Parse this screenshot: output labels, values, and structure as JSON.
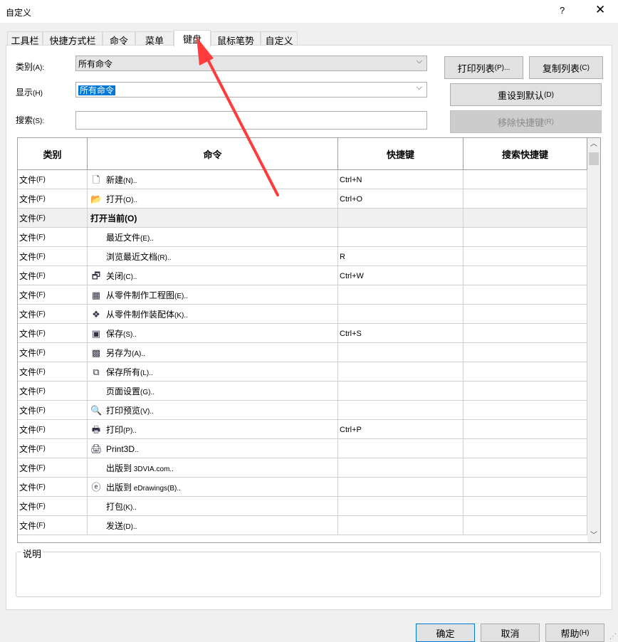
{
  "window": {
    "title": "自定义",
    "help_glyph": "?",
    "close_glyph": "✕"
  },
  "tabs": [
    {
      "label": "工具栏"
    },
    {
      "label": "快捷方式栏"
    },
    {
      "label": "命令"
    },
    {
      "label": "菜单"
    },
    {
      "label": "键盘",
      "active": true
    },
    {
      "label": "鼠标笔势"
    },
    {
      "label": "自定义"
    }
  ],
  "filters": {
    "category_label": "类别",
    "category_accel": "(A):",
    "category_value": "所有命令",
    "show_label": "显示",
    "show_accel": "(H)",
    "show_value": "所有命令",
    "search_label": "搜索",
    "search_accel": "(S):",
    "search_value": ""
  },
  "buttons": {
    "print_list": "打印列表",
    "print_list_accel": "(P)...",
    "copy_list": "复制列表",
    "copy_list_accel": "(C)",
    "reset_default": "重设到默认",
    "reset_default_accel": "(D)",
    "remove_shortcut": "移除快捷键",
    "remove_shortcut_accel": "(R)"
  },
  "table": {
    "headers": [
      "类别",
      "命令",
      "快捷键",
      "搜索快捷键"
    ],
    "rows": [
      {
        "cat": "文件",
        "cat_accel": "(F)",
        "cmd": "新建",
        "cmd_accel": "(N)..",
        "key": "Ctrl+N",
        "icon": "new-document-icon",
        "glyph": "🗋"
      },
      {
        "cat": "文件",
        "cat_accel": "(F)",
        "cmd": "打开",
        "cmd_accel": "(O)..",
        "key": "Ctrl+O",
        "icon": "open-folder-icon",
        "glyph": "📂"
      },
      {
        "cat": "文件",
        "cat_accel": "(F)",
        "cmd": "打开当前(O)",
        "cmd_accel": "",
        "key": "",
        "icon": "",
        "glyph": "",
        "group": true
      },
      {
        "cat": "文件",
        "cat_accel": "(F)",
        "cmd": "最近文件",
        "cmd_accel": "(E)..",
        "key": "",
        "icon": "",
        "glyph": ""
      },
      {
        "cat": "文件",
        "cat_accel": "(F)",
        "cmd": "浏览最近文档",
        "cmd_accel": "(R)..",
        "key": "R",
        "icon": "",
        "glyph": ""
      },
      {
        "cat": "文件",
        "cat_accel": "(F)",
        "cmd": "关闭",
        "cmd_accel": "(C)..",
        "key": "Ctrl+W",
        "icon": "close-document-icon",
        "glyph": "🗗"
      },
      {
        "cat": "文件",
        "cat_accel": "(F)",
        "cmd": "从零件制作工程图",
        "cmd_accel": "(E)..",
        "key": "",
        "icon": "make-drawing-icon",
        "glyph": "▦"
      },
      {
        "cat": "文件",
        "cat_accel": "(F)",
        "cmd": "从零件制作装配体",
        "cmd_accel": "(K)..",
        "key": "",
        "icon": "make-assembly-icon",
        "glyph": "❖"
      },
      {
        "cat": "文件",
        "cat_accel": "(F)",
        "cmd": "保存",
        "cmd_accel": "(S)..",
        "key": "Ctrl+S",
        "icon": "save-icon",
        "glyph": "▣"
      },
      {
        "cat": "文件",
        "cat_accel": "(F)",
        "cmd": "另存为",
        "cmd_accel": "(A)..",
        "key": "",
        "icon": "save-as-icon",
        "glyph": "▩"
      },
      {
        "cat": "文件",
        "cat_accel": "(F)",
        "cmd": "保存所有",
        "cmd_accel": "(L)..",
        "key": "",
        "icon": "save-all-icon",
        "glyph": "⧉"
      },
      {
        "cat": "文件",
        "cat_accel": "(F)",
        "cmd": "页面设置",
        "cmd_accel": "(G)..",
        "key": "",
        "icon": "",
        "glyph": ""
      },
      {
        "cat": "文件",
        "cat_accel": "(F)",
        "cmd": "打印预览",
        "cmd_accel": "(V)..",
        "key": "",
        "icon": "print-preview-icon",
        "glyph": "🔍"
      },
      {
        "cat": "文件",
        "cat_accel": "(F)",
        "cmd": "打印",
        "cmd_accel": "(P)..",
        "key": "Ctrl+P",
        "icon": "print-icon",
        "glyph": "🖶"
      },
      {
        "cat": "文件",
        "cat_accel": "(F)",
        "cmd": "Print3D",
        "cmd_accel": "..",
        "key": "",
        "icon": "print3d-icon",
        "glyph": "🖨"
      },
      {
        "cat": "文件",
        "cat_accel": "(F)",
        "cmd": "出版到",
        "cmd_accel": " 3DVIA.com..",
        "key": "",
        "icon": "",
        "glyph": ""
      },
      {
        "cat": "文件",
        "cat_accel": "(F)",
        "cmd": "出版到",
        "cmd_accel": " eDrawings(B)..",
        "key": "",
        "icon": "edrawings-icon",
        "glyph": "ⓔ"
      },
      {
        "cat": "文件",
        "cat_accel": "(F)",
        "cmd": "打包",
        "cmd_accel": "(K)..",
        "key": "",
        "icon": "",
        "glyph": ""
      },
      {
        "cat": "文件",
        "cat_accel": "(F)",
        "cmd": "发送",
        "cmd_accel": "(D)..",
        "key": "",
        "icon": "",
        "glyph": ""
      }
    ]
  },
  "description": {
    "label": "说明"
  },
  "footer": {
    "ok": "确定",
    "cancel": "取消",
    "help": "帮助",
    "help_accel": "(H)"
  },
  "colors": {
    "accent": "#0078d7",
    "arrow": "#ff3b3b"
  }
}
